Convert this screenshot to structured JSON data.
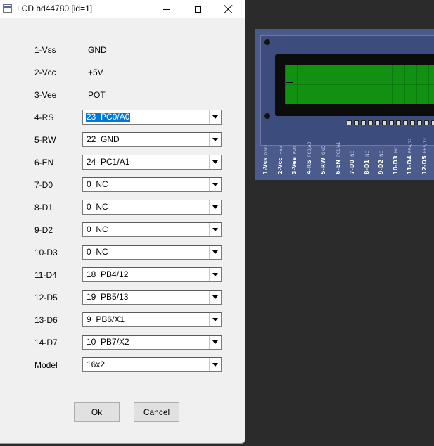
{
  "window": {
    "title": "LCD hd44780 [id=1]"
  },
  "rows": [
    {
      "label": "1-Vss",
      "value": "GND",
      "kind": "static"
    },
    {
      "label": "2-Vcc",
      "value": "+5V",
      "kind": "static"
    },
    {
      "label": "3-Vee",
      "value": "POT",
      "kind": "static"
    },
    {
      "label": "4-RS",
      "value": "23  PC0/A0",
      "kind": "combo",
      "selected": true
    },
    {
      "label": "5-RW",
      "value": "22  GND",
      "kind": "combo"
    },
    {
      "label": "6-EN",
      "value": "24  PC1/A1",
      "kind": "combo"
    },
    {
      "label": "7-D0",
      "value": "0  NC",
      "kind": "combo"
    },
    {
      "label": "8-D1",
      "value": "0  NC",
      "kind": "combo"
    },
    {
      "label": "9-D2",
      "value": "0  NC",
      "kind": "combo"
    },
    {
      "label": "10-D3",
      "value": "0  NC",
      "kind": "combo"
    },
    {
      "label": "11-D4",
      "value": "18  PB4/12",
      "kind": "combo"
    },
    {
      "label": "12-D5",
      "value": "19  PB5/13",
      "kind": "combo"
    },
    {
      "label": "13-D6",
      "value": "9  PB6/X1",
      "kind": "combo"
    },
    {
      "label": "14-D7",
      "value": "10  PB7/X2",
      "kind": "combo"
    },
    {
      "label": "Model",
      "value": "16x2",
      "kind": "combo"
    }
  ],
  "buttons": {
    "ok": "Ok",
    "cancel": "Cancel"
  },
  "lcd": {
    "pins": [
      {
        "name": "1-Vss",
        "signal": "GND"
      },
      {
        "name": "2-Vcc",
        "signal": "+5V"
      },
      {
        "name": "3-Vee",
        "signal": "POT"
      },
      {
        "name": "4-RS",
        "signal": "PC0/A0"
      },
      {
        "name": "5-RW",
        "signal": "GND"
      },
      {
        "name": "6-EN",
        "signal": "PC1/A1"
      },
      {
        "name": "7-D0",
        "signal": "NC"
      },
      {
        "name": "8-D1",
        "signal": "NC"
      },
      {
        "name": "9-D2",
        "signal": "NC"
      },
      {
        "name": "10-D3",
        "signal": "NC"
      },
      {
        "name": "11-D4",
        "signal": "PB4/12"
      },
      {
        "name": "12-D5",
        "signal": "PB5/13"
      },
      {
        "name": "13-D6",
        "signal": "PB6/X1"
      }
    ],
    "colors": {
      "board": "#4a5b8c",
      "screen": "#129012",
      "bezel": "#0c0c0c"
    }
  }
}
